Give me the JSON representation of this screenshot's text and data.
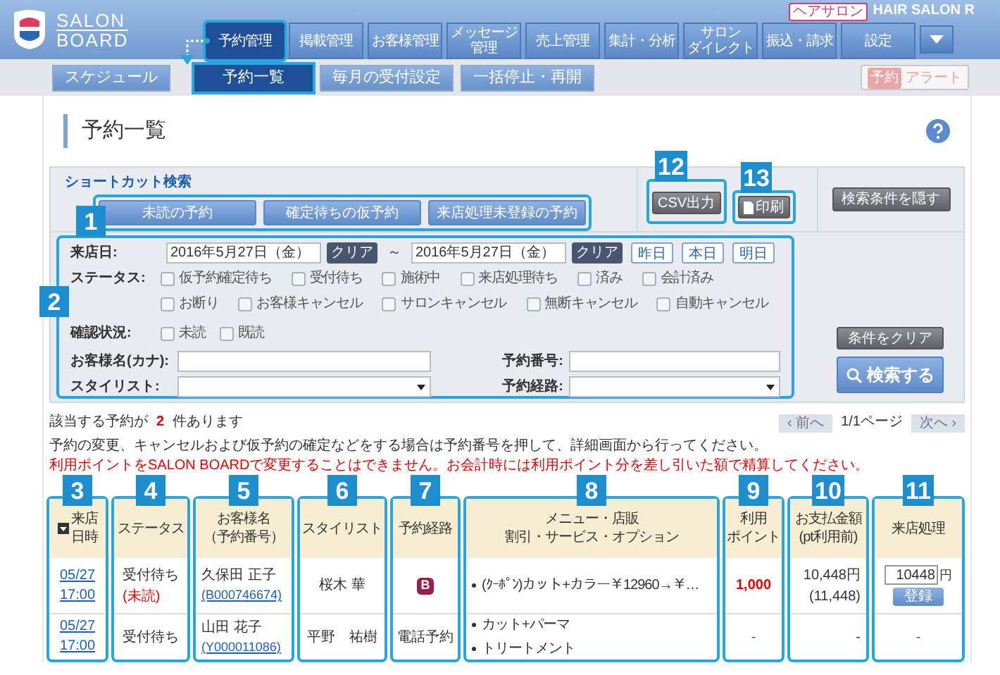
{
  "header": {
    "logo": {
      "line1": "SALON",
      "line2": "BOARD"
    },
    "shop_type": "ヘアサロン",
    "shop_name": "HAIR SALON R",
    "tabs": [
      {
        "lines": [
          "予約管理"
        ],
        "selected": true
      },
      {
        "lines": [
          "掲載管理"
        ],
        "selected": false
      },
      {
        "lines": [
          "お客様管理"
        ],
        "selected": false
      },
      {
        "lines": [
          "メッセージ",
          "管理"
        ],
        "selected": false
      },
      {
        "lines": [
          "売上管理"
        ],
        "selected": false
      },
      {
        "lines": [
          "集計・分析"
        ],
        "selected": false
      },
      {
        "lines": [
          "サロン",
          "ダイレクト"
        ],
        "selected": false
      },
      {
        "lines": [
          "振込・請求"
        ],
        "selected": false
      },
      {
        "lines": [
          "設定"
        ],
        "selected": false
      }
    ]
  },
  "subnav": {
    "items": [
      {
        "label": "スケジュール",
        "selected": false
      },
      {
        "label": "予約一覧",
        "selected": true
      },
      {
        "label": "毎月の受付設定",
        "selected": false
      },
      {
        "label": "一括停止・再開",
        "selected": false
      }
    ],
    "alert": {
      "badge": "予約",
      "label": "アラート",
      "disabled": true
    }
  },
  "page_title": "予約一覧",
  "shortcut": {
    "title": "ショートカット検索",
    "callout": "1",
    "buttons": [
      "未読の予約",
      "確定待ちの仮予約",
      "来店処理未登録の予約"
    ]
  },
  "export": {
    "csv": {
      "label": "CSV出力",
      "callout": "12"
    },
    "print": {
      "label": "印刷",
      "callout": "13"
    }
  },
  "hide_button": "検索条件を隠す",
  "search": {
    "callout": "2",
    "date": {
      "label": "来店日:",
      "from": "2016年5月27日（金）",
      "from_clear": "クリア",
      "separator": "～",
      "to": "2016年5月27日（金）",
      "to_clear": "クリア",
      "quick": [
        "昨日",
        "本日",
        "明日"
      ]
    },
    "status": {
      "label": "ステータス:",
      "options": [
        {
          "label": "仮予約確定待ち",
          "checked": false
        },
        {
          "label": "受付待ち",
          "checked": false
        },
        {
          "label": "施術中",
          "checked": false
        },
        {
          "label": "来店処理待ち",
          "checked": false
        },
        {
          "label": "済み",
          "checked": false
        },
        {
          "label": "会計済み",
          "checked": false
        },
        {
          "label": "お断り",
          "checked": false
        },
        {
          "label": "お客様キャンセル",
          "checked": false
        },
        {
          "label": "サロンキャンセル",
          "checked": false
        },
        {
          "label": "無断キャンセル",
          "checked": false
        },
        {
          "label": "自動キャンセル",
          "checked": false
        }
      ]
    },
    "confirm": {
      "label": "確認状況:",
      "options": [
        {
          "label": "未読",
          "checked": false
        },
        {
          "label": "既読",
          "checked": false
        }
      ]
    },
    "customer_name": {
      "label": "お客様名(カナ):"
    },
    "reservation_number": {
      "label": "予約番号:"
    },
    "stylist": {
      "label": "スタイリスト:"
    },
    "route": {
      "label": "予約経路:"
    },
    "clear_button": "条件をクリア",
    "search_button": "検索する"
  },
  "results": {
    "summary": {
      "prefix": "該当する予約が",
      "count": "2",
      "suffix": "件あります"
    },
    "pagination": {
      "prev": "‹ 前へ",
      "page": "1/1ページ",
      "next": "次へ ›",
      "prev_disabled": true,
      "next_disabled": true
    },
    "notice": "予約の変更、キャンセルおよび仮予約の確定などをする場合は予約番号を押して、詳細画面から行ってください。",
    "warning": "利用ポイントをSALON BOARDで変更することはできません。お会計時には利用ポイント分を差し引いた額で精算してください。"
  },
  "table": {
    "columns": [
      {
        "callout": "3",
        "lines": [
          "来店",
          "日時"
        ]
      },
      {
        "callout": "4",
        "lines": [
          "ステータス"
        ]
      },
      {
        "callout": "5",
        "lines": [
          "お客様名",
          "（予約番号）"
        ]
      },
      {
        "callout": "6",
        "lines": [
          "スタイリスト"
        ]
      },
      {
        "callout": "7",
        "lines": [
          "予約経路"
        ]
      },
      {
        "callout": "8",
        "lines": [
          "メニュー・店販",
          "割引・サービス・オプション"
        ]
      },
      {
        "callout": "9",
        "lines": [
          "利用",
          "ポイント"
        ]
      },
      {
        "callout": "10",
        "lines": [
          "お支払金額",
          "(pt利用前)"
        ]
      },
      {
        "callout": "11",
        "lines": [
          "来店処理"
        ]
      }
    ],
    "rows": [
      {
        "date": "05/27",
        "time": "17:00",
        "status": "受付待ち",
        "status_note": "(未読)",
        "customer": "久保田 正子",
        "number": "(B000746674)",
        "stylist": "桜木 華",
        "route": {
          "kind": "icon",
          "label": "B"
        },
        "menu": [
          "(ｸｰﾎﾟﾝ)カット+カラー￥12960→￥…"
        ],
        "points": {
          "text": "1,000",
          "highlight": true
        },
        "amount": "10,448円",
        "amount_note": "(11,448)",
        "checkin": {
          "kind": "form",
          "value": "10448",
          "unit": "円",
          "button": "登録"
        }
      },
      {
        "date": "05/27",
        "time": "17:00",
        "status": "受付待ち",
        "customer": "山田 花子",
        "number": "(Y000011086)",
        "stylist": "平野　祐樹",
        "route": {
          "kind": "text",
          "label": "電話予約"
        },
        "menu": [
          "カット+パーマ",
          "トリートメント"
        ],
        "points": {
          "text": "-",
          "highlight": false
        },
        "amount": "-",
        "checkin": {
          "kind": "text",
          "label": "-"
        }
      }
    ]
  }
}
